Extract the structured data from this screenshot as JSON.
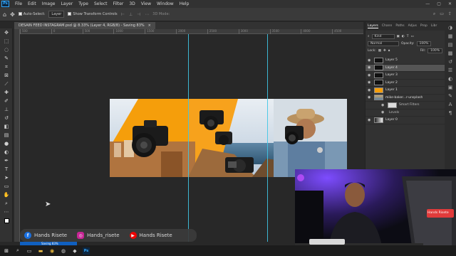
{
  "menubar": {
    "logo": "Ps",
    "items": [
      "File",
      "Edit",
      "Image",
      "Layer",
      "Type",
      "Select",
      "Filter",
      "3D",
      "View",
      "Window",
      "Help"
    ]
  },
  "options": {
    "auto_select_label": "Auto-Select:",
    "auto_select_value": "Layer",
    "show_transform_label": "Show Transform Controls",
    "mode_3d_label": "3D Mode:"
  },
  "document_tab": {
    "title": "DESAIN FEED INSTAGRAM.psd @ 8.33% (Layer 4, RGB/8) - Saving 83%",
    "close": "×"
  },
  "ruler": {
    "ticks": [
      "500",
      "0",
      "500",
      "1000",
      "1500",
      "2000",
      "2500",
      "3000",
      "3500",
      "4000",
      "4500"
    ]
  },
  "panels": {
    "tabs": [
      "Layers",
      "Chann",
      "Paths",
      "Adjus",
      "Prop",
      "Libr"
    ],
    "active_tab": "Layers",
    "filter_kind": "Kind",
    "blend_mode": "Normal",
    "opacity_label": "Opacity:",
    "opacity_value": "100%",
    "lock_label": "Lock:",
    "fill_label": "Fill:",
    "fill_value": "100%",
    "layers": [
      {
        "name": "Layer 5",
        "thumb": "dark",
        "selected": false
      },
      {
        "name": "Layer 4",
        "thumb": "dark",
        "selected": true
      },
      {
        "name": "Layer 3",
        "thumb": "dark",
        "selected": false
      },
      {
        "name": "Layer 2",
        "thumb": "dark",
        "selected": false
      },
      {
        "name": "Layer 1",
        "thumb": "orange",
        "selected": false
      },
      {
        "name": "mike-baker...r-unsplash",
        "thumb": "photo",
        "selected": false
      },
      {
        "name": "Smart Filters",
        "thumb": "light",
        "selected": false,
        "sub": true
      },
      {
        "name": "Levels",
        "thumb": "none",
        "selected": false,
        "sub": true
      },
      {
        "name": "Layer 0",
        "thumb": "grad",
        "selected": false
      }
    ]
  },
  "social": {
    "facebook": "Hands Risete",
    "instagram": "Hands_risete",
    "youtube": "Hands Risete"
  },
  "webcam": {
    "sign_text": "Hands Risete"
  },
  "status": {
    "saving": "Saving 83%"
  },
  "colors": {
    "accent_orange": "#f59e0b",
    "guide_cyan": "#3fc7e6",
    "facebook": "#1877f2",
    "instagram": "#d6249f",
    "youtube": "#ff0000"
  }
}
